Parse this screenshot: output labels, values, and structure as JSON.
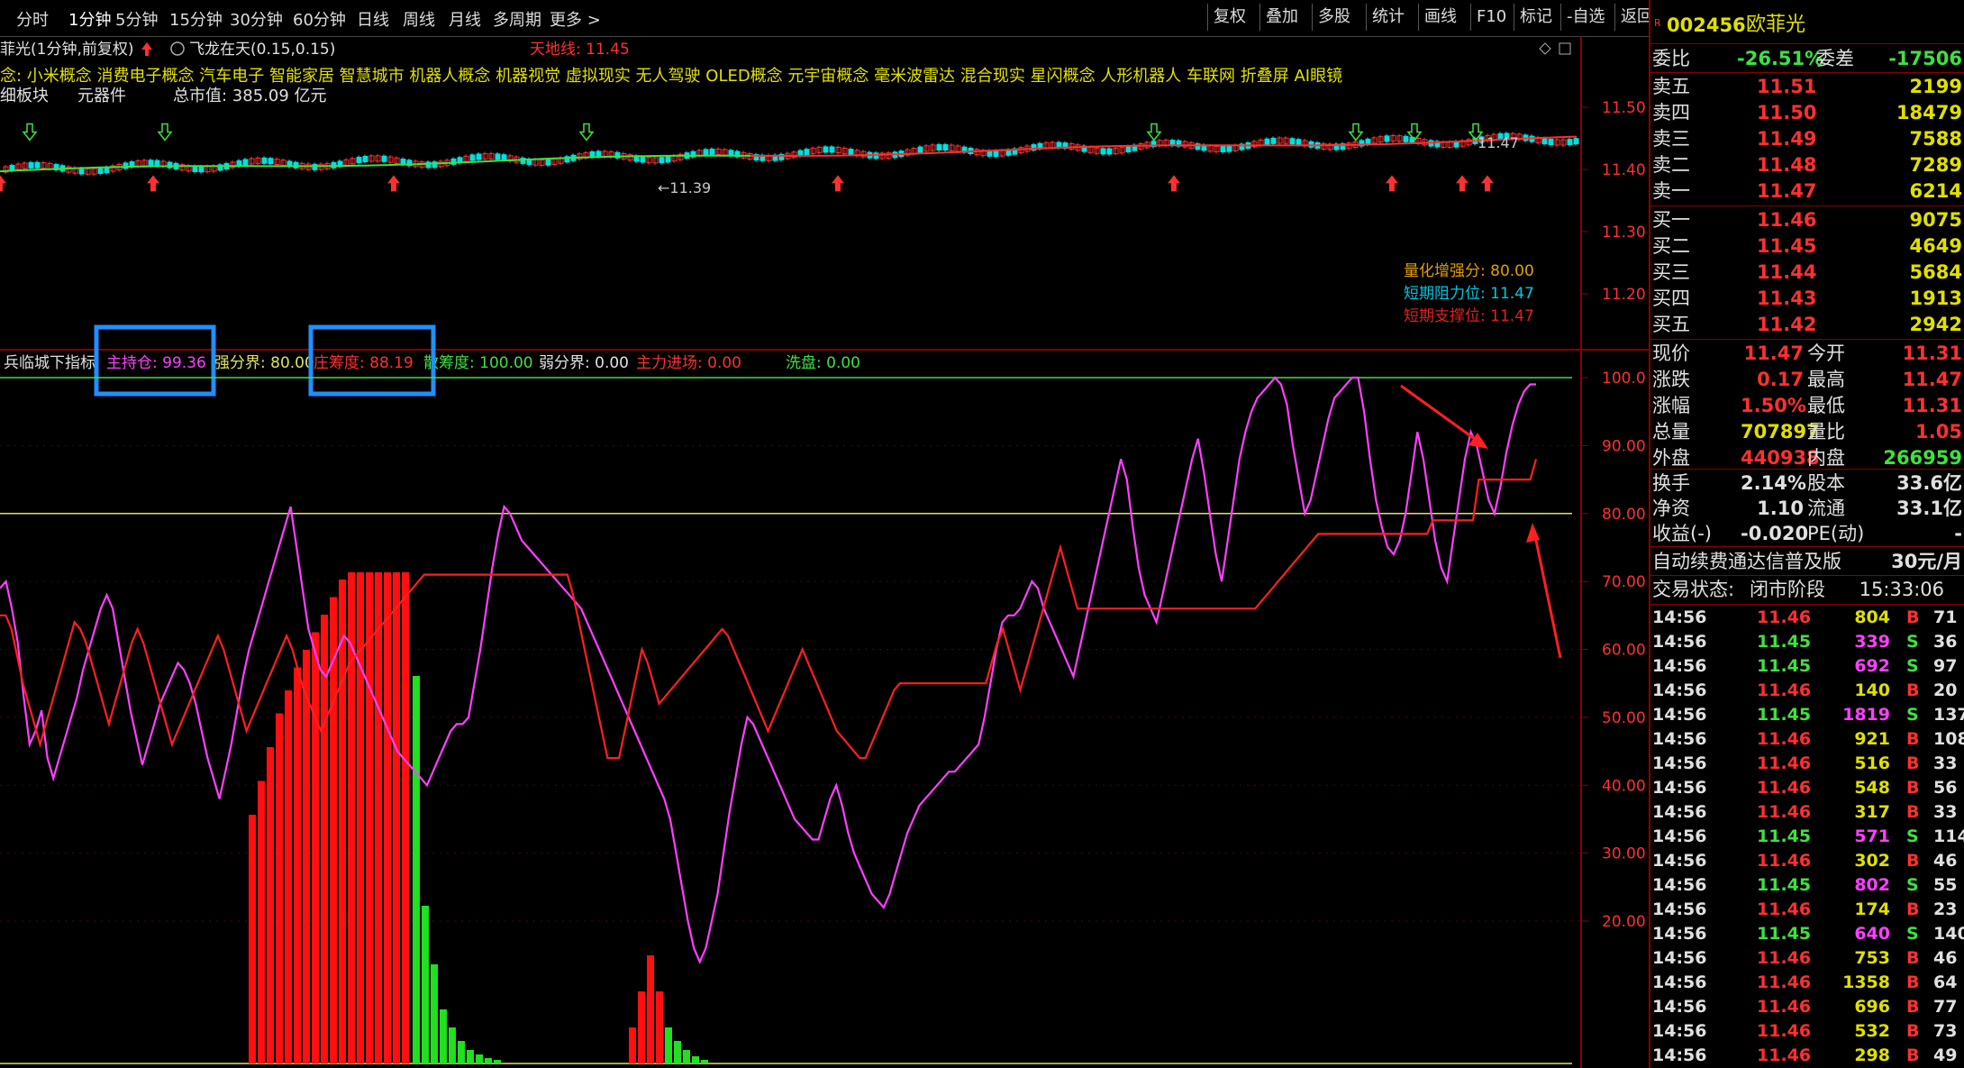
{
  "toolbar": {
    "tabs": [
      "分时",
      "1分钟",
      "5分钟",
      "15分钟",
      "30分钟",
      "60分钟",
      "日线",
      "周线",
      "月线",
      "多周期",
      "更多 >"
    ],
    "active_tab": "1分钟",
    "right_buttons": [
      "复权",
      "叠加",
      "多股",
      "统计",
      "画线",
      "F10",
      "标记",
      "-自选",
      "返回"
    ]
  },
  "main_chart": {
    "title": "菲光(1分钟,前复权)",
    "indicator_name": "飞龙在天(0.15,0.15)",
    "tiandi_label": "天地线: 11.45",
    "concepts": "念: 小米概念 消费电子概念 汽车电子 智能家居 智慧城市 机器人概念 机器视觉 虚拟现实 无人驾驶 OLED概念 元宇宙概念 毫米波雷达 混合现实 星闪概念 人形机器人 车联网 折叠屏 AI眼镜",
    "sector_label": "细板块",
    "sector_value": "元器件",
    "market_cap": "总市值: 385.09 亿元",
    "low_annotation": "←11.39",
    "high_annotation": "11.47",
    "y_ticks": [
      "11.50",
      "11.40",
      "11.30",
      "11.20"
    ],
    "info_labels": [
      {
        "text": "量化增强分: 80.00",
        "color": "#e0a000"
      },
      {
        "text": "短期阻力位: 11.47",
        "color": "#00c8e0"
      },
      {
        "text": "短期支撑位: 11.47",
        "color": "#e02020"
      }
    ]
  },
  "sub_chart": {
    "indicator_name": "兵临城下指标",
    "legend": [
      {
        "text": "主持仓: 99.36",
        "color": "#ff40ff"
      },
      {
        "text": "强分界: 80.00",
        "color": "#e0e060"
      },
      {
        "text": "庄筹度: 88.19",
        "color": "#ff3030"
      },
      {
        "text": "散筹度: 100.00",
        "color": "#40e040"
      },
      {
        "text": "弱分界: 0.00",
        "color": "#e0e0e0"
      },
      {
        "text": "主力进场: 0.00",
        "color": "#ff3030"
      },
      {
        "text": "洗盘: 0.00",
        "color": "#40e040"
      }
    ],
    "y_ticks": [
      "100.0",
      "90.00",
      "80.00",
      "70.00",
      "60.00",
      "50.00",
      "40.00",
      "30.00",
      "20.00"
    ]
  },
  "chart_data": {
    "type": "line",
    "ylim": [
      10,
      100
    ],
    "series": [
      {
        "name": "主持仓",
        "color": "#ff40ff",
        "values": [
          69,
          70,
          66,
          61,
          53,
          46,
          48,
          51,
          44,
          41,
          44,
          47,
          50,
          53,
          57,
          60,
          63,
          66,
          68,
          66,
          61,
          56,
          51,
          47,
          43,
          46,
          49,
          52,
          54,
          56,
          58,
          57,
          55,
          52,
          48,
          44,
          41,
          38,
          42,
          46,
          51,
          56,
          60,
          63,
          66,
          69,
          72,
          75,
          78,
          81,
          75,
          69,
          63,
          60,
          57,
          56,
          58,
          60,
          62,
          61,
          59,
          57,
          55,
          53,
          51,
          49,
          47,
          45,
          44,
          43,
          42,
          41,
          40,
          42,
          44,
          46,
          48,
          49,
          49,
          50,
          55,
          60,
          66,
          72,
          77,
          81,
          80,
          78,
          76,
          75,
          74,
          73,
          72,
          71,
          70,
          69,
          68,
          67,
          66,
          64,
          62,
          60,
          58,
          56,
          54,
          52,
          50,
          48,
          46,
          44,
          42,
          40,
          38,
          35,
          30,
          25,
          20,
          16,
          14,
          16,
          20,
          24,
          30,
          36,
          41,
          46,
          50,
          49,
          47,
          45,
          43,
          41,
          39,
          37,
          35,
          34,
          33,
          32,
          32,
          35,
          38,
          40,
          37,
          33,
          30,
          28,
          26,
          24,
          23,
          22,
          24,
          27,
          30,
          33,
          35,
          37,
          38,
          39,
          40,
          41,
          42,
          42,
          43,
          44,
          45,
          46,
          50,
          55,
          60,
          64,
          65,
          65,
          66,
          68,
          70,
          69,
          66,
          64,
          62,
          60,
          58,
          56,
          60,
          64,
          68,
          72,
          76,
          80,
          84,
          88,
          85,
          78,
          72,
          68,
          66,
          64,
          68,
          72,
          76,
          80,
          84,
          88,
          91,
          86,
          80,
          74,
          70,
          76,
          82,
          88,
          92,
          95,
          97,
          98,
          99,
          100,
          99,
          96,
          90,
          85,
          80,
          82,
          86,
          90,
          94,
          97,
          98,
          99,
          100,
          100,
          95,
          88,
          82,
          78,
          75,
          74,
          76,
          80,
          86,
          92,
          88,
          82,
          76,
          72,
          70,
          76,
          82,
          88,
          92,
          90,
          86,
          82,
          80,
          84,
          89,
          93,
          96,
          98,
          99,
          99
        ]
      },
      {
        "name": "庄筹度",
        "color": "#ff2020",
        "values": [
          65,
          65,
          63,
          59,
          55,
          52,
          49,
          46,
          49,
          52,
          55,
          58,
          61,
          64,
          63,
          61,
          58,
          55,
          52,
          49,
          52,
          55,
          58,
          61,
          63,
          61,
          58,
          55,
          52,
          49,
          46,
          48,
          50,
          52,
          54,
          56,
          58,
          60,
          62,
          60,
          57,
          54,
          51,
          48,
          50,
          52,
          54,
          56,
          58,
          60,
          62,
          60,
          57,
          54,
          52,
          50,
          48,
          50,
          52,
          54,
          56,
          58,
          59,
          60,
          61,
          62,
          63,
          64,
          65,
          66,
          67,
          68,
          69,
          70,
          71,
          71,
          71,
          71,
          71,
          71,
          71,
          71,
          71,
          71,
          71,
          71,
          71,
          71,
          71,
          71,
          71,
          71,
          71,
          71,
          71,
          71,
          71,
          71,
          71,
          71,
          68,
          64,
          60,
          56,
          52,
          48,
          44,
          44,
          44,
          48,
          52,
          56,
          60,
          58,
          55,
          52,
          53,
          54,
          55,
          56,
          57,
          58,
          59,
          60,
          61,
          62,
          63,
          62,
          60,
          58,
          56,
          54,
          52,
          50,
          48,
          50,
          52,
          54,
          56,
          58,
          60,
          58,
          56,
          54,
          52,
          50,
          48,
          47,
          46,
          45,
          44,
          44,
          46,
          48,
          50,
          52,
          54,
          55,
          55,
          55,
          55,
          55,
          55,
          55,
          55,
          55,
          55,
          55,
          55,
          55,
          55,
          55,
          55,
          58,
          61,
          63,
          60,
          57,
          54,
          57,
          60,
          63,
          66,
          69,
          72,
          75,
          72,
          69,
          66,
          66,
          66,
          66,
          66,
          66,
          66,
          66,
          66,
          66,
          66,
          66,
          66,
          66,
          66,
          66,
          66,
          66,
          66,
          66,
          66,
          66,
          66,
          66,
          66,
          66,
          66,
          66,
          66,
          66,
          66,
          66,
          67,
          68,
          69,
          70,
          71,
          72,
          73,
          74,
          75,
          76,
          77,
          77,
          77,
          77,
          77,
          77,
          77,
          77,
          77,
          77,
          77,
          77,
          77,
          77,
          77,
          77,
          77,
          77,
          77,
          77,
          79,
          79,
          79,
          79,
          79,
          79,
          79,
          79,
          85,
          85,
          85,
          85,
          85,
          85,
          85,
          85,
          85,
          85,
          88
        ]
      }
    ]
  },
  "quote": {
    "code": "002456",
    "name": "欧菲光",
    "weibi": {
      "label": "委比",
      "pct": "-26.51%",
      "label2": "委差",
      "diff": "-17506"
    },
    "asks": [
      {
        "label": "卖五",
        "price": "11.51",
        "vol": "2199"
      },
      {
        "label": "卖四",
        "price": "11.50",
        "vol": "18479"
      },
      {
        "label": "卖三",
        "price": "11.49",
        "vol": "7588"
      },
      {
        "label": "卖二",
        "price": "11.48",
        "vol": "7289"
      },
      {
        "label": "卖一",
        "price": "11.47",
        "vol": "6214"
      }
    ],
    "bids": [
      {
        "label": "买一",
        "price": "11.46",
        "vol": "9075"
      },
      {
        "label": "买二",
        "price": "11.45",
        "vol": "4649"
      },
      {
        "label": "买三",
        "price": "11.44",
        "vol": "5684"
      },
      {
        "label": "买四",
        "price": "11.43",
        "vol": "1913"
      },
      {
        "label": "买五",
        "price": "11.42",
        "vol": "2942"
      }
    ],
    "stats": [
      {
        "l1": "现价",
        "v1": "11.47",
        "c1": "#ff3030",
        "l2": "今开",
        "v2": "11.31",
        "c2": "#ff3030"
      },
      {
        "l1": "涨跌",
        "v1": "0.17",
        "c1": "#ff3030",
        "l2": "最高",
        "v2": "11.47",
        "c2": "#ff3030"
      },
      {
        "l1": "涨幅",
        "v1": "1.50%",
        "c1": "#ff3030",
        "l2": "最低",
        "v2": "11.31",
        "c2": "#ff3030"
      },
      {
        "l1": "总量",
        "v1": "707897",
        "c1": "#e0e000",
        "l2": "量比",
        "v2": "1.05",
        "c2": "#ff3030"
      },
      {
        "l1": "外盘",
        "v1": "440938",
        "c1": "#ff3030",
        "l2": "内盘",
        "v2": "266959",
        "c2": "#40e040"
      }
    ],
    "stats2": [
      {
        "l1": "换手",
        "v1": "2.14%",
        "c1": "#e0e0e0",
        "l2": "股本",
        "v2": "33.6亿",
        "c2": "#e0e0e0"
      },
      {
        "l1": "净资",
        "v1": "1.10",
        "c1": "#e0e0e0",
        "l2": "流通",
        "v2": "33.1亿",
        "c2": "#e0e0e0"
      },
      {
        "l1": "收益(-)",
        "v1": "-0.020",
        "c1": "#e0e0e0",
        "l2": "PE(动)",
        "v2": "-",
        "c2": "#e0e0e0"
      }
    ],
    "promo": {
      "text": "自动续费通达信普及版",
      "price": "30元/月"
    },
    "trade_status": {
      "label": "交易状态:",
      "value": "闭市阶段",
      "time": "15:33:06"
    },
    "ticks": [
      {
        "t": "14:56",
        "p": "11.46",
        "v": "804",
        "s": "B",
        "n": "71"
      },
      {
        "t": "14:56",
        "p": "11.45",
        "v": "339",
        "s": "S",
        "n": "36"
      },
      {
        "t": "14:56",
        "p": "11.45",
        "v": "692",
        "s": "S",
        "n": "97"
      },
      {
        "t": "14:56",
        "p": "11.46",
        "v": "140",
        "s": "B",
        "n": "20"
      },
      {
        "t": "14:56",
        "p": "11.45",
        "v": "1819",
        "s": "S",
        "n": "137"
      },
      {
        "t": "14:56",
        "p": "11.46",
        "v": "921",
        "s": "B",
        "n": "108"
      },
      {
        "t": "14:56",
        "p": "11.46",
        "v": "516",
        "s": "B",
        "n": "33"
      },
      {
        "t": "14:56",
        "p": "11.46",
        "v": "548",
        "s": "B",
        "n": "56"
      },
      {
        "t": "14:56",
        "p": "11.46",
        "v": "317",
        "s": "B",
        "n": "33"
      },
      {
        "t": "14:56",
        "p": "11.45",
        "v": "571",
        "s": "S",
        "n": "114"
      },
      {
        "t": "14:56",
        "p": "11.46",
        "v": "302",
        "s": "B",
        "n": "46"
      },
      {
        "t": "14:56",
        "p": "11.45",
        "v": "802",
        "s": "S",
        "n": "55"
      },
      {
        "t": "14:56",
        "p": "11.46",
        "v": "174",
        "s": "B",
        "n": "23"
      },
      {
        "t": "14:56",
        "p": "11.45",
        "v": "640",
        "s": "S",
        "n": "140"
      },
      {
        "t": "14:56",
        "p": "11.46",
        "v": "753",
        "s": "B",
        "n": "46"
      },
      {
        "t": "14:56",
        "p": "11.46",
        "v": "1358",
        "s": "B",
        "n": "64"
      },
      {
        "t": "14:56",
        "p": "11.46",
        "v": "696",
        "s": "B",
        "n": "77"
      },
      {
        "t": "14:56",
        "p": "11.46",
        "v": "532",
        "s": "B",
        "n": "73"
      },
      {
        "t": "14:56",
        "p": "11.46",
        "v": "298",
        "s": "B",
        "n": "49"
      }
    ]
  },
  "colors": {
    "up": "#ff3030",
    "down": "#40e040",
    "magenta": "#ff40ff",
    "yellow": "#e0e000",
    "cyan": "#00c8e0",
    "frame": "#8a0000",
    "highlight": "#1e90ff"
  }
}
